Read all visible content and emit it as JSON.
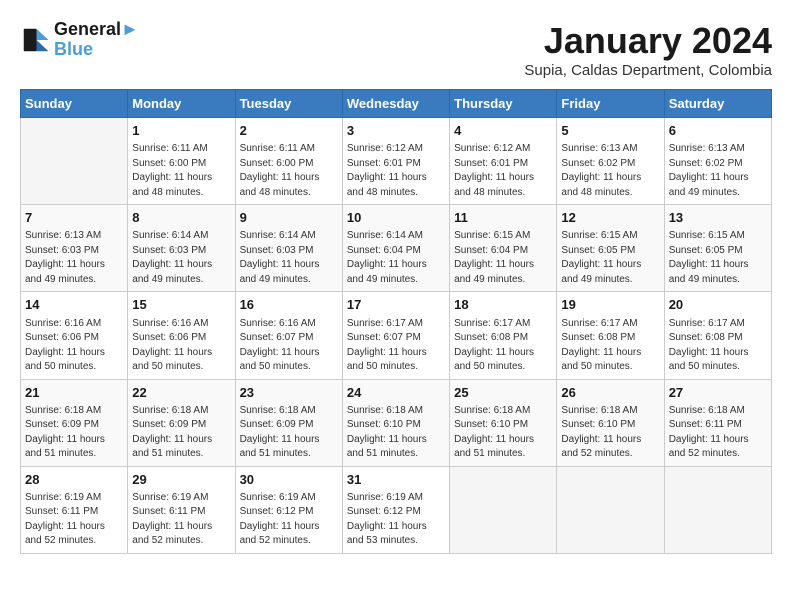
{
  "logo": {
    "line1": "General",
    "line2": "Blue"
  },
  "title": "January 2024",
  "subtitle": "Supia, Caldas Department, Colombia",
  "days_header": [
    "Sunday",
    "Monday",
    "Tuesday",
    "Wednesday",
    "Thursday",
    "Friday",
    "Saturday"
  ],
  "weeks": [
    [
      {
        "num": "",
        "info": ""
      },
      {
        "num": "1",
        "info": "Sunrise: 6:11 AM\nSunset: 6:00 PM\nDaylight: 11 hours\nand 48 minutes."
      },
      {
        "num": "2",
        "info": "Sunrise: 6:11 AM\nSunset: 6:00 PM\nDaylight: 11 hours\nand 48 minutes."
      },
      {
        "num": "3",
        "info": "Sunrise: 6:12 AM\nSunset: 6:01 PM\nDaylight: 11 hours\nand 48 minutes."
      },
      {
        "num": "4",
        "info": "Sunrise: 6:12 AM\nSunset: 6:01 PM\nDaylight: 11 hours\nand 48 minutes."
      },
      {
        "num": "5",
        "info": "Sunrise: 6:13 AM\nSunset: 6:02 PM\nDaylight: 11 hours\nand 48 minutes."
      },
      {
        "num": "6",
        "info": "Sunrise: 6:13 AM\nSunset: 6:02 PM\nDaylight: 11 hours\nand 49 minutes."
      }
    ],
    [
      {
        "num": "7",
        "info": "Sunrise: 6:13 AM\nSunset: 6:03 PM\nDaylight: 11 hours\nand 49 minutes."
      },
      {
        "num": "8",
        "info": "Sunrise: 6:14 AM\nSunset: 6:03 PM\nDaylight: 11 hours\nand 49 minutes."
      },
      {
        "num": "9",
        "info": "Sunrise: 6:14 AM\nSunset: 6:03 PM\nDaylight: 11 hours\nand 49 minutes."
      },
      {
        "num": "10",
        "info": "Sunrise: 6:14 AM\nSunset: 6:04 PM\nDaylight: 11 hours\nand 49 minutes."
      },
      {
        "num": "11",
        "info": "Sunrise: 6:15 AM\nSunset: 6:04 PM\nDaylight: 11 hours\nand 49 minutes."
      },
      {
        "num": "12",
        "info": "Sunrise: 6:15 AM\nSunset: 6:05 PM\nDaylight: 11 hours\nand 49 minutes."
      },
      {
        "num": "13",
        "info": "Sunrise: 6:15 AM\nSunset: 6:05 PM\nDaylight: 11 hours\nand 49 minutes."
      }
    ],
    [
      {
        "num": "14",
        "info": "Sunrise: 6:16 AM\nSunset: 6:06 PM\nDaylight: 11 hours\nand 50 minutes."
      },
      {
        "num": "15",
        "info": "Sunrise: 6:16 AM\nSunset: 6:06 PM\nDaylight: 11 hours\nand 50 minutes."
      },
      {
        "num": "16",
        "info": "Sunrise: 6:16 AM\nSunset: 6:07 PM\nDaylight: 11 hours\nand 50 minutes."
      },
      {
        "num": "17",
        "info": "Sunrise: 6:17 AM\nSunset: 6:07 PM\nDaylight: 11 hours\nand 50 minutes."
      },
      {
        "num": "18",
        "info": "Sunrise: 6:17 AM\nSunset: 6:08 PM\nDaylight: 11 hours\nand 50 minutes."
      },
      {
        "num": "19",
        "info": "Sunrise: 6:17 AM\nSunset: 6:08 PM\nDaylight: 11 hours\nand 50 minutes."
      },
      {
        "num": "20",
        "info": "Sunrise: 6:17 AM\nSunset: 6:08 PM\nDaylight: 11 hours\nand 50 minutes."
      }
    ],
    [
      {
        "num": "21",
        "info": "Sunrise: 6:18 AM\nSunset: 6:09 PM\nDaylight: 11 hours\nand 51 minutes."
      },
      {
        "num": "22",
        "info": "Sunrise: 6:18 AM\nSunset: 6:09 PM\nDaylight: 11 hours\nand 51 minutes."
      },
      {
        "num": "23",
        "info": "Sunrise: 6:18 AM\nSunset: 6:09 PM\nDaylight: 11 hours\nand 51 minutes."
      },
      {
        "num": "24",
        "info": "Sunrise: 6:18 AM\nSunset: 6:10 PM\nDaylight: 11 hours\nand 51 minutes."
      },
      {
        "num": "25",
        "info": "Sunrise: 6:18 AM\nSunset: 6:10 PM\nDaylight: 11 hours\nand 51 minutes."
      },
      {
        "num": "26",
        "info": "Sunrise: 6:18 AM\nSunset: 6:10 PM\nDaylight: 11 hours\nand 52 minutes."
      },
      {
        "num": "27",
        "info": "Sunrise: 6:18 AM\nSunset: 6:11 PM\nDaylight: 11 hours\nand 52 minutes."
      }
    ],
    [
      {
        "num": "28",
        "info": "Sunrise: 6:19 AM\nSunset: 6:11 PM\nDaylight: 11 hours\nand 52 minutes."
      },
      {
        "num": "29",
        "info": "Sunrise: 6:19 AM\nSunset: 6:11 PM\nDaylight: 11 hours\nand 52 minutes."
      },
      {
        "num": "30",
        "info": "Sunrise: 6:19 AM\nSunset: 6:12 PM\nDaylight: 11 hours\nand 52 minutes."
      },
      {
        "num": "31",
        "info": "Sunrise: 6:19 AM\nSunset: 6:12 PM\nDaylight: 11 hours\nand 53 minutes."
      },
      {
        "num": "",
        "info": ""
      },
      {
        "num": "",
        "info": ""
      },
      {
        "num": "",
        "info": ""
      }
    ]
  ]
}
